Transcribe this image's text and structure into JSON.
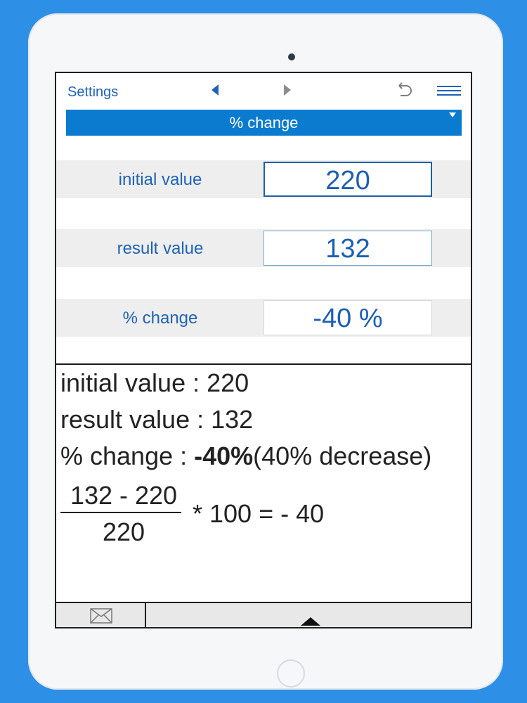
{
  "toolbar": {
    "settings_label": "Settings",
    "icons": [
      "back-arrow-icon",
      "forward-arrow-icon",
      "undo-icon",
      "menu-icon"
    ]
  },
  "mode": {
    "selected": "% change"
  },
  "fields": [
    {
      "label": "initial value",
      "value": "220"
    },
    {
      "label": "result value",
      "value": "132"
    },
    {
      "label": "% change",
      "value": "-40 %"
    }
  ],
  "explanation": {
    "line1": "initial value : 220",
    "line2": "result value : 132",
    "line3_prefix": "% change : ",
    "line3_bold": "-40%",
    "line3_suffix": "(40% decrease)",
    "fraction_numerator": "132 - 220",
    "fraction_denominator": "220",
    "fraction_rest": "* 100 = - 40"
  },
  "colors": {
    "background": "#2e8fe6",
    "accent": "#0b7bd0",
    "text_blue": "#1f63b5"
  }
}
